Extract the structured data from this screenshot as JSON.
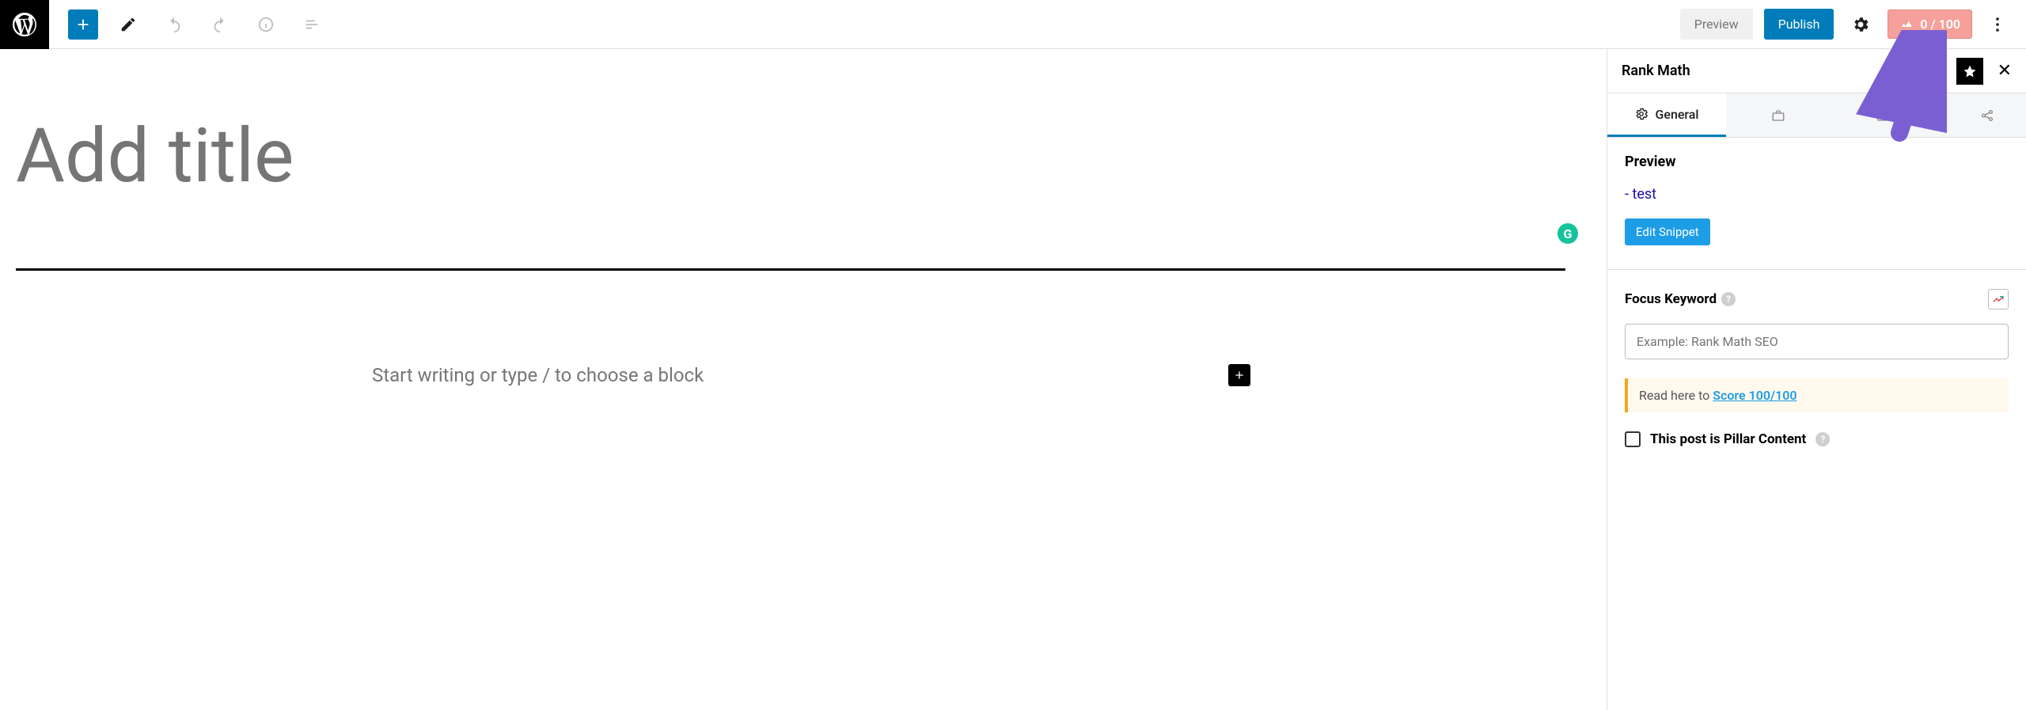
{
  "topbar": {
    "preview_label": "Preview",
    "publish_label": "Publish",
    "score_text": "0 / 100"
  },
  "editor": {
    "title_placeholder": "Add title",
    "block_hint": "Start writing or type / to choose a block"
  },
  "sidebar": {
    "title": "Rank Math",
    "tabs": {
      "general": "General"
    },
    "preview": {
      "heading": "Preview",
      "link_text": "- test",
      "edit_button": "Edit Snippet"
    },
    "focus_keyword": {
      "label": "Focus Keyword",
      "placeholder": "Example: Rank Math SEO"
    },
    "notice": {
      "prefix": "Read here to ",
      "link": "Score 100/100"
    },
    "pillar": {
      "label": "This post is Pillar Content"
    }
  }
}
